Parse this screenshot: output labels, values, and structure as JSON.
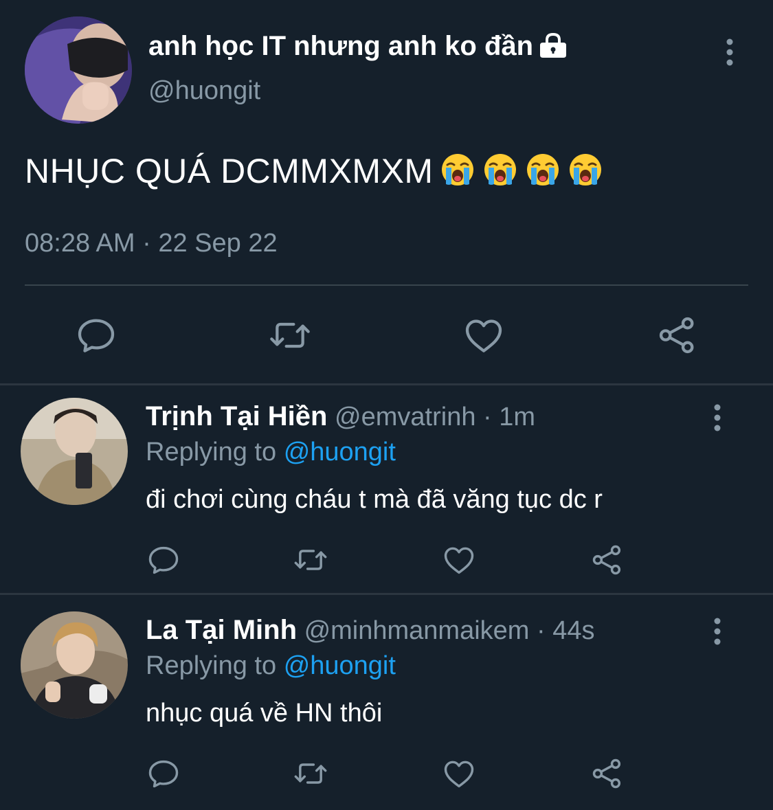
{
  "main_tweet": {
    "author_name": "anh học IT nhưng anh ko đần",
    "author_handle": "@huongit",
    "text": "NHỤC QUÁ DCMMXMXM",
    "emojis": [
      "😭",
      "😭",
      "😭",
      "😭"
    ],
    "timestamp": "08:28 AM · 22 Sep 22"
  },
  "replies": [
    {
      "name": "Trịnh Tại Hiền",
      "handle": "@emvatrinh",
      "time": "1m",
      "replying_prefix": "Replying to",
      "replying_to": "@huongit",
      "text": "đi chơi cùng cháu t mà đã văng tục dc r"
    },
    {
      "name": "La Tại Minh",
      "handle": "@minhmanmaikem",
      "time": "44s",
      "replying_prefix": "Replying to",
      "replying_to": "@huongit",
      "text": "nhục quá về HN thôi"
    }
  ],
  "icons": {
    "reply": "speech-bubble-icon",
    "retweet": "retweet-icon",
    "like": "heart-icon",
    "share": "share-icon",
    "more": "vertical-dots-icon",
    "protected": "lock-icon"
  },
  "colors": {
    "background": "#15202b",
    "text": "#ffffff",
    "secondary_text": "#8899a6",
    "mention": "#1da1f2",
    "divider": "#38444d"
  }
}
